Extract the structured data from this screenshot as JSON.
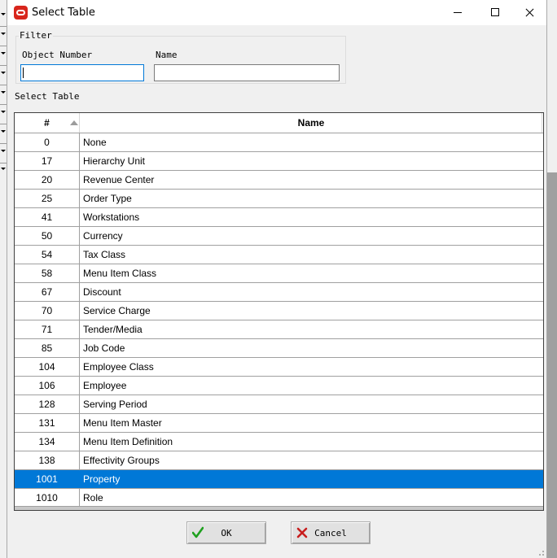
{
  "window": {
    "title": "Select Table"
  },
  "filter": {
    "group_label": "Filter",
    "object_number_label": "Object Number",
    "object_number_value": "",
    "name_label": "Name",
    "name_value": ""
  },
  "table": {
    "section_label": "Select Table",
    "columns": [
      "#",
      "Name"
    ],
    "rows": [
      {
        "num": "0",
        "name": "None"
      },
      {
        "num": "17",
        "name": "Hierarchy Unit"
      },
      {
        "num": "20",
        "name": "Revenue Center"
      },
      {
        "num": "25",
        "name": "Order Type"
      },
      {
        "num": "41",
        "name": "Workstations"
      },
      {
        "num": "50",
        "name": "Currency"
      },
      {
        "num": "54",
        "name": "Tax Class"
      },
      {
        "num": "58",
        "name": "Menu Item Class"
      },
      {
        "num": "67",
        "name": "Discount"
      },
      {
        "num": "70",
        "name": "Service Charge"
      },
      {
        "num": "71",
        "name": "Tender/Media"
      },
      {
        "num": "85",
        "name": "Job Code"
      },
      {
        "num": "104",
        "name": "Employee Class"
      },
      {
        "num": "106",
        "name": "Employee"
      },
      {
        "num": "128",
        "name": "Serving Period"
      },
      {
        "num": "131",
        "name": "Menu Item Master"
      },
      {
        "num": "134",
        "name": "Menu Item Definition"
      },
      {
        "num": "138",
        "name": "Effectivity Groups"
      },
      {
        "num": "1001",
        "name": "Property"
      },
      {
        "num": "1010",
        "name": "Role"
      }
    ],
    "selected_index": 18
  },
  "buttons": {
    "ok": "OK",
    "cancel": "Cancel"
  },
  "colors": {
    "selection": "#0078d7",
    "app_icon": "#d8261c"
  },
  "icons": {
    "app": "oracle-icon",
    "ok": "green-check-icon",
    "cancel": "red-x-icon"
  }
}
